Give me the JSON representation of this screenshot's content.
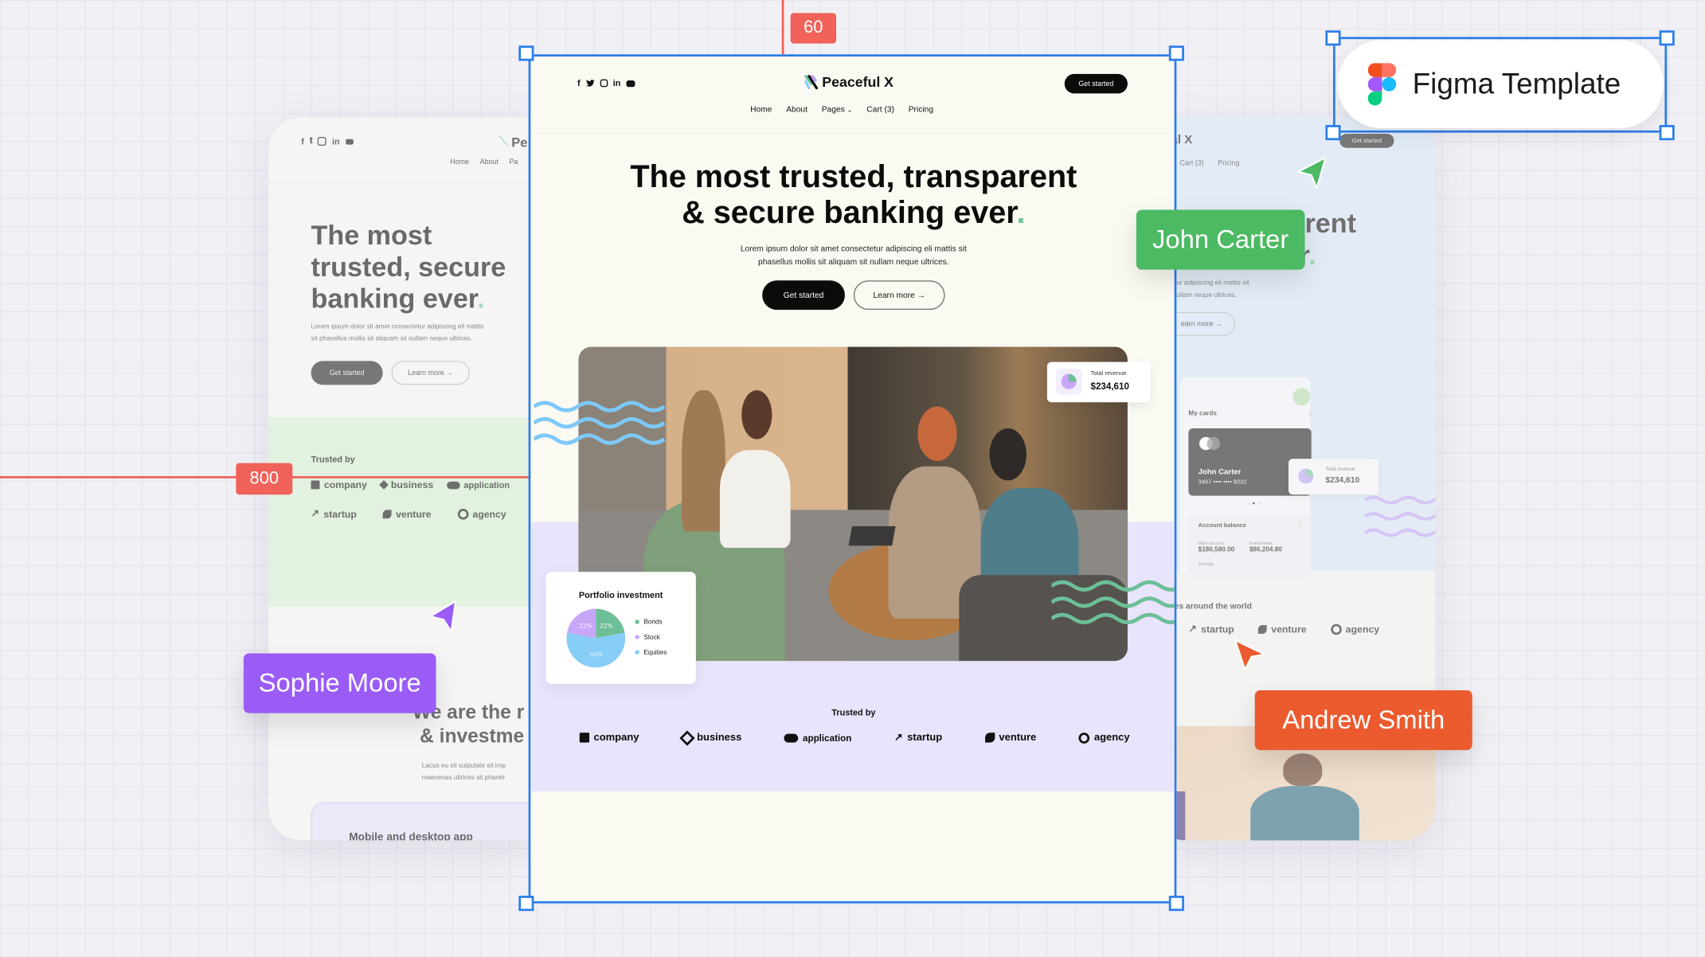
{
  "colors": {
    "selection_blue": "#2b7de9",
    "ruler_red": "#f0625a",
    "main_bg": "#fafaf3",
    "main_lavender": "#e8e4fb",
    "accent_dot": "#6cc3a0",
    "john_carter": "#4cb963",
    "sophie_moore": "#9a5cf5",
    "andrew_smith": "#eb5b2e"
  },
  "rulers": {
    "top_value": "60",
    "left_value": "800"
  },
  "figma_badge": {
    "label": "Figma Template",
    "icon": "figma-logo-icon"
  },
  "collaborators": [
    {
      "name": "John Carter",
      "color": "#4cb963",
      "icon": "cursor-arrow-icon"
    },
    {
      "name": "Sophie Moore",
      "color": "#9a5cf5",
      "icon": "cursor-arrow-icon"
    },
    {
      "name": "Andrew Smith",
      "color": "#eb5b2e",
      "icon": "cursor-arrow-icon"
    }
  ],
  "main": {
    "social_icons": [
      "facebook-icon",
      "twitter-icon",
      "instagram-icon",
      "linkedin-icon",
      "youtube-icon"
    ],
    "brand": "Peaceful X",
    "cta": "Get started",
    "nav": [
      "Home",
      "About",
      "Pages",
      "Cart (3)",
      "Pricing"
    ],
    "headline_line1": "The most trusted, transparent",
    "headline_line2": "& secure banking ever",
    "headline_dot": ".",
    "subtext_line1": "Lorem ipsum dolor sit amet consectetur adipiscing eli mattis sit",
    "subtext_line2": "phasellus mollis sit aliquam sit nullam neque ultrices.",
    "primary_button": "Get started",
    "secondary_button": "Learn more →",
    "revenue_card": {
      "label": "Total revenue",
      "value": "$234,610"
    },
    "portfolio": {
      "title": "Portfolio investment",
      "slices": [
        {
          "label": "Bonds",
          "value": 22,
          "pct": "22%",
          "color": "#6dbf98"
        },
        {
          "label": "Equities",
          "value": 56,
          "pct": "56%",
          "color": "#86cdf7"
        },
        {
          "label": "Stock",
          "value": 22,
          "pct": "22%",
          "color": "#c7a6f7"
        }
      ],
      "legend": [
        "Bonds",
        "Stock",
        "Equities"
      ]
    },
    "trusted_title": "Trusted by",
    "logos": [
      "company",
      "business",
      "application",
      "startup",
      "venture",
      "agency"
    ]
  },
  "left_preview": {
    "brand_partial": "Pe",
    "nav": [
      "Home",
      "About",
      "Pa"
    ],
    "headline": [
      "The most",
      "trusted,  secure",
      "banking ever"
    ],
    "headline_dot": ".",
    "subtext_line1": "Lorem ipsum dolor sit amet consectetur adipiscing eli mattis",
    "subtext_line2": "sit phasellus mollis sit aliquam sit nullam neque ultrices.",
    "primary_button": "Get started",
    "secondary_button": "Learn more →",
    "trusted_title": "Trusted by",
    "logos_row1": [
      "company",
      "business",
      "application"
    ],
    "logos_row2": [
      "startup",
      "venture",
      "agency"
    ],
    "section2_line1": "We are the r",
    "section2_line2": "& investme",
    "section2_text1": "Lacus eu sit vulputate sit imp",
    "section2_text2": "maecenas ultrices sit pharetr",
    "app_card_title": "Mobile and desktop app"
  },
  "right_preview": {
    "brand_partial": "al X",
    "cta": "Get started",
    "nav": [
      "Cart (3)",
      "Pricing"
    ],
    "headline_line1": "rent",
    "headline_line2": "r",
    "headline_dot": ".",
    "subtext_line1": "ur adipiscing eli mattis sit",
    "subtext_line2": "ullam neque ultrices.",
    "secondary_button": "earn more →",
    "dashboard": {
      "my_cards": "My cards",
      "card_holder": "John Carter",
      "card_number": "3467 •••• •••• 9032",
      "revenue_label": "Total revenue",
      "revenue_value": "$234,610",
      "balance_title": "Account balance",
      "main_account_label": "Main account",
      "main_account_value": "$180,580.00",
      "investments_label": "Investments",
      "investments_value": "$86,204.80",
      "savings_label": "Savings"
    },
    "world_title": "es around the world",
    "logos": [
      "startup",
      "venture",
      "agency"
    ]
  }
}
